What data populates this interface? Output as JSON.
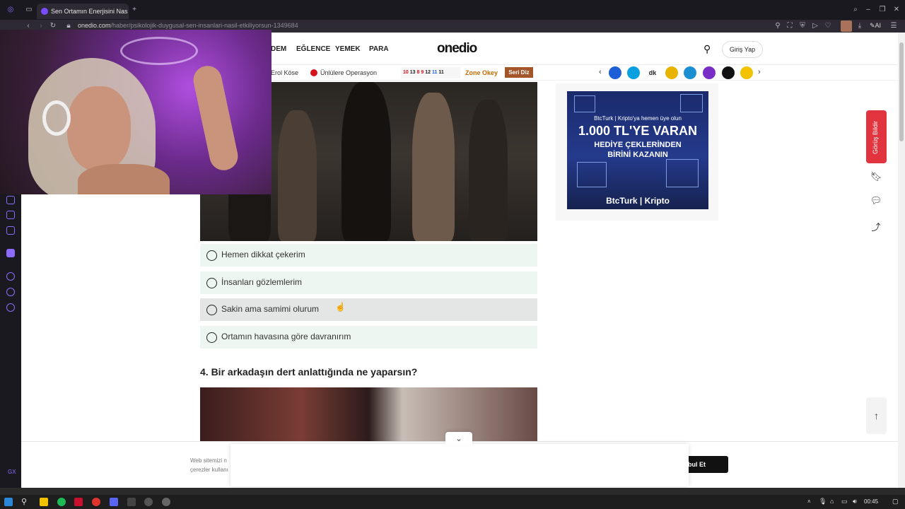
{
  "browser": {
    "tab_title": "Sen Ortamın Enerjisini Nas",
    "url_host": "onedio.com",
    "url_path": "/haber/psikolojik-duygusal-sen-insanlari-nasil-etkiliyorsun-1349684",
    "new_tab": "+",
    "ai_label": "AI"
  },
  "header": {
    "nav": [
      "DEM",
      "EĞLENCE",
      "YEMEK",
      "PARA"
    ],
    "logo": "onedio",
    "login": "Giriş Yap"
  },
  "subnav": {
    "items": [
      "Erol Köse",
      "Ünlülere Operasyon"
    ],
    "numbers": [
      "10",
      "13",
      "8",
      "9",
      "12",
      "11",
      "11"
    ],
    "zone_okey": "Zone Okey",
    "seri_diz": "Seri Diz",
    "brand_colors": [
      "#1e5fd8",
      "#0aa0e0",
      "#222222",
      "#e8b400",
      "#1a8fd1",
      "#7a2cc7",
      "#111111",
      "#f2c200"
    ]
  },
  "quiz": {
    "options": [
      "Hemen dikkat çekerim",
      "İnsanları gözlemlerim",
      "Sakin ama samimi olurum",
      "Ortamın havasına göre davranırım"
    ],
    "question4": "4. Bir arkadaşın dert anlattığında ne yaparsın?"
  },
  "ad": {
    "line1": "BtcTurk | Kripto'ya hemen üye olun",
    "line2": "1.000 TL'YE VARAN",
    "line3": "HEDİYE ÇEKLERİNDEN",
    "line4": "BİRİNİ KAZANIN",
    "brand": "BtcTurk | Kripto"
  },
  "floating": {
    "feedback": "Görüş Bildir",
    "back_to_top": "↑"
  },
  "cookie": {
    "text_line1": "Web sitemizi n",
    "text_line2": "çerezler kullanı",
    "accept": "bul Et",
    "toggle": "⌄"
  },
  "taskbar": {
    "time": "00:45"
  },
  "colors": {
    "accent": "#e2343f",
    "option_bg": "#eef6f1",
    "browser_dark": "#1b1920"
  }
}
